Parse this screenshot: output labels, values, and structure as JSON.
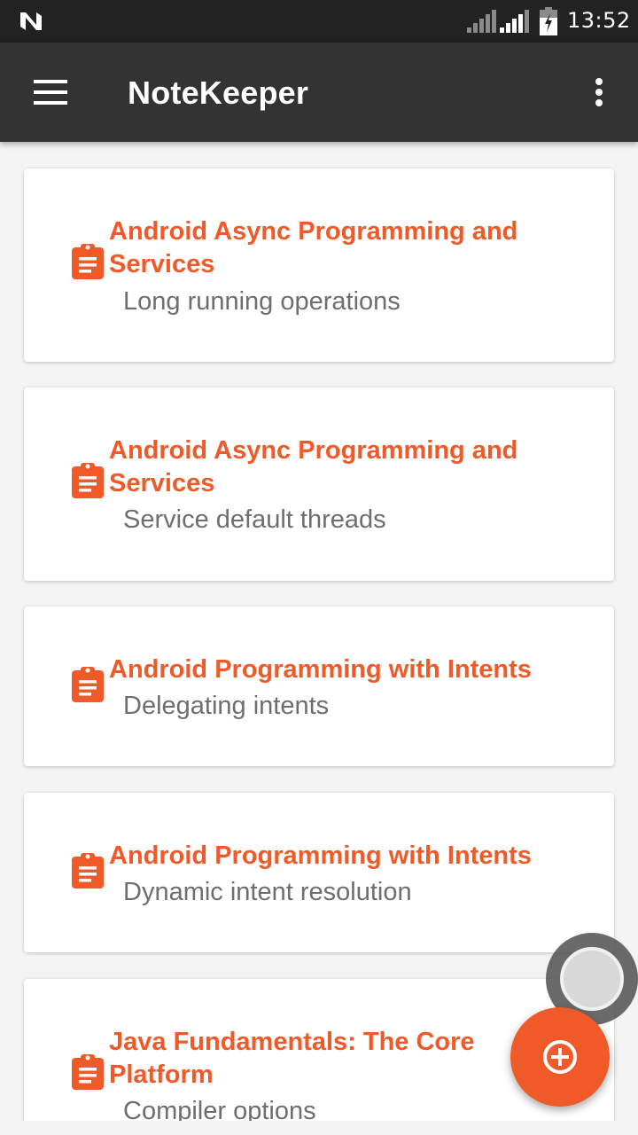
{
  "status_bar": {
    "time": "13:52",
    "icons": [
      "n-logo-icon",
      "signal-icon",
      "signal-icon",
      "battery-icon"
    ]
  },
  "app_bar": {
    "title": "NoteKeeper",
    "menu_icon": "hamburger-menu-icon",
    "overflow_icon": "more-vert-icon"
  },
  "notes": [
    {
      "title": "Android Async Programming and Services",
      "text": "Long running operations"
    },
    {
      "title": "Android Async Programming and Services",
      "text": "Service default threads"
    },
    {
      "title": "Android Programming with Intents",
      "text": "Delegating intents"
    },
    {
      "title": "Android Programming with Intents",
      "text": "Dynamic intent resolution"
    },
    {
      "title": "Java Fundamentals: The Core Platform",
      "text": "Compiler options"
    }
  ],
  "fab": {
    "icon": "add-circle-icon"
  },
  "colors": {
    "accent": "#f05a28",
    "app_bar": "#333333",
    "status_bar": "#222222",
    "background": "#f4f4f4"
  }
}
